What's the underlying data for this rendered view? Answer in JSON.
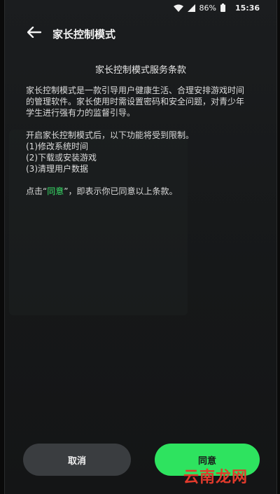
{
  "status_bar": {
    "battery": "86%",
    "time": "15:36",
    "icons": [
      "wifi-icon",
      "cellular-signal-icon",
      "battery-icon"
    ]
  },
  "app_bar": {
    "back_icon": "arrow-left-icon",
    "title": "家长控制模式"
  },
  "terms": {
    "heading": "家长控制模式服务条款",
    "intro_line1": "家长控制模式是一款引导用户健康生活、合理安排游戏时间",
    "intro_line2": "的管理软件。家长使用时需设置密码和安全问题，对青少年",
    "intro_line3": "学生进行强有力的监督引导。",
    "restrict_intro": "开启家长控制模式后，以下功能将受到限制。",
    "restrictions": [
      "(1)修改系统时间",
      "(2)下载或安装游戏",
      "(3)清理用户数据"
    ],
    "agree_prefix": "点击“",
    "agree_word": "同意",
    "agree_suffix": "”，即表示你已同意以上条款。"
  },
  "buttons": {
    "cancel_label": "取消",
    "agree_label": "同意"
  },
  "watermark": "云南龙网",
  "colors": {
    "accent": "#2ee35f",
    "background": "#161819",
    "cancel_button": "#3a3d40",
    "watermark": "#e23a2c"
  }
}
